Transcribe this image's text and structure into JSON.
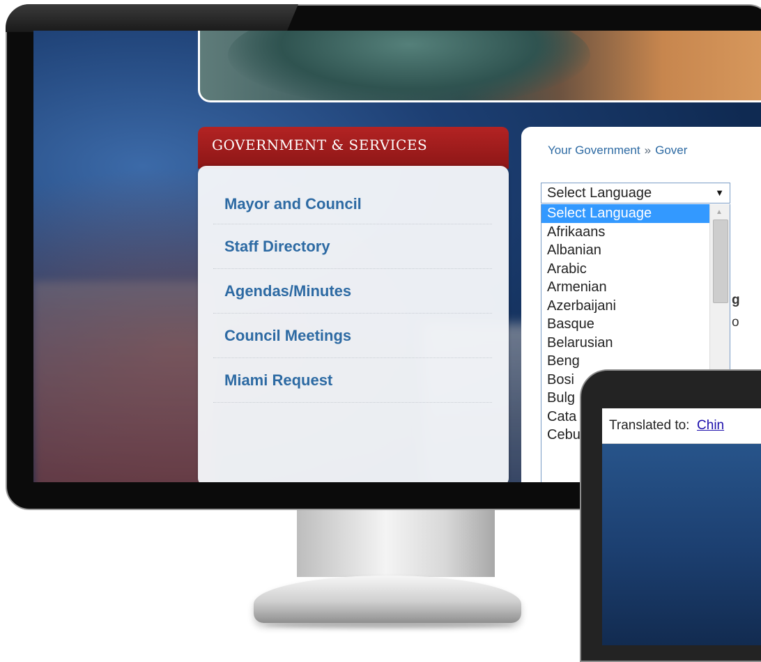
{
  "sidebar": {
    "title": "GOVERNMENT & SERVICES",
    "items": [
      {
        "label": "Mayor and Council"
      },
      {
        "label": "Staff Directory"
      },
      {
        "label": "Agendas/Minutes"
      },
      {
        "label": "Council Meetings"
      },
      {
        "label": "Miami Request"
      }
    ]
  },
  "breadcrumb": {
    "item1": "Your Government",
    "separator": "»",
    "item2": "Gover"
  },
  "language": {
    "selected": "Select Language",
    "options": [
      "Select Language",
      "Afrikaans",
      "Albanian",
      "Arabic",
      "Armenian",
      "Azerbaijani",
      "Basque",
      "Belarusian",
      "Beng",
      "Bosi",
      "Bulg",
      "Cata",
      "Cebu"
    ],
    "highlighted_index": 0
  },
  "content_peek": {
    "a": "g",
    "b": "o"
  },
  "tablet": {
    "prefix": "Translated to:",
    "link": "Chin"
  },
  "colors": {
    "sidebar_header": "#a61c1c",
    "link_blue": "#2d6aa3",
    "selection_blue": "#3399ff"
  }
}
